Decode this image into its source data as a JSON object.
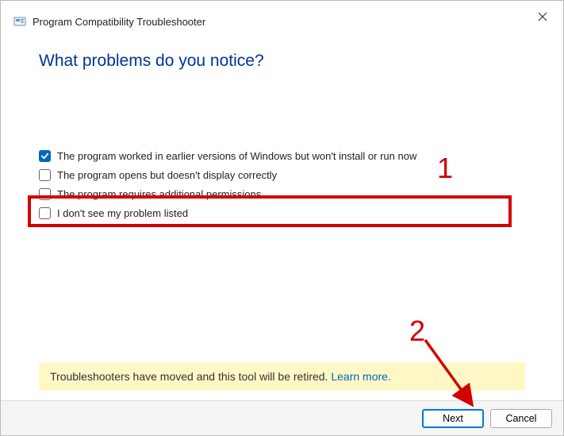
{
  "header": {
    "title": "Program Compatibility Troubleshooter"
  },
  "main": {
    "heading": "What problems do you notice?"
  },
  "options": [
    {
      "label": "The program worked in earlier versions of Windows but won't install or run now",
      "checked": true
    },
    {
      "label": "The program opens but doesn't display correctly",
      "checked": false
    },
    {
      "label": "The program requires additional permissions",
      "checked": false
    },
    {
      "label": "I don't see my problem listed",
      "checked": false
    }
  ],
  "notice": {
    "text": "Troubleshooters have moved and this tool will be retired. ",
    "link_label": "Learn more."
  },
  "footer": {
    "next_label": "Next",
    "cancel_label": "Cancel"
  },
  "annotations": {
    "mark1": "1",
    "mark2": "2",
    "highlight_color": "#d40000"
  }
}
